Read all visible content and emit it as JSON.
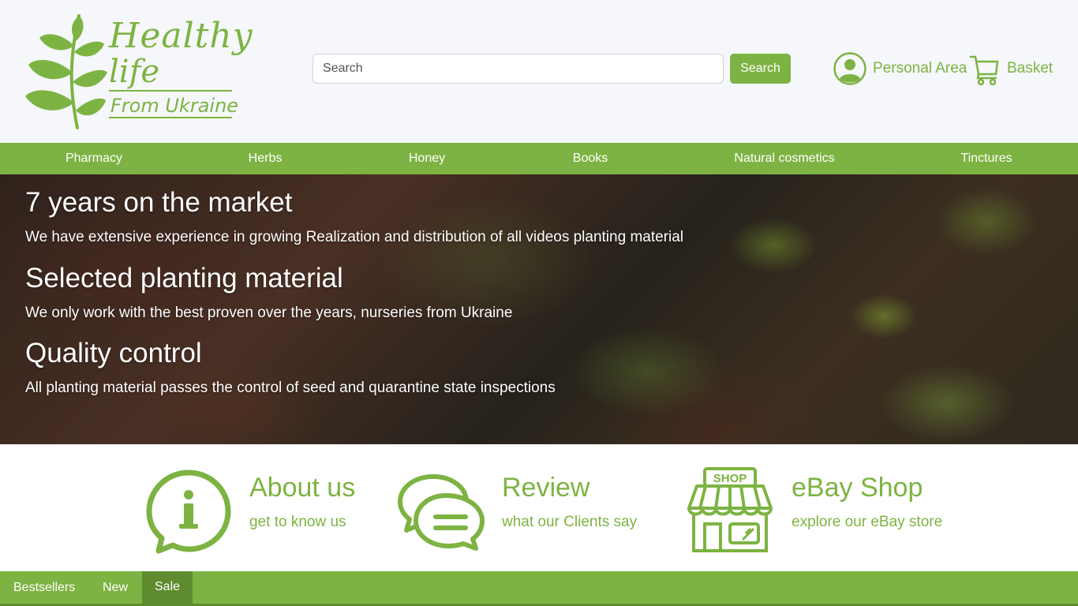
{
  "brand": {
    "logo_line1": "Healthy",
    "logo_line2": "life",
    "logo_line3": "From Ukraine",
    "accent_color": "#7db342"
  },
  "header": {
    "search": {
      "placeholder": "Search",
      "value": "",
      "button_label": "Search"
    },
    "account_label": "Personal Area",
    "account_icon": "user-circle-icon",
    "basket_label": "Basket",
    "basket_icon": "cart-icon"
  },
  "nav": {
    "items": [
      "Pharmacy",
      "Herbs",
      "Honey",
      "Books",
      "Natural cosmetics",
      "Tinctures"
    ]
  },
  "hero": {
    "blocks": [
      {
        "title": "7 years on the market",
        "text": "We have extensive experience in growing Realization and distribution of all videos planting material"
      },
      {
        "title": "Selected planting material",
        "text": "We only work with the best proven over the years, nurseries from Ukraine"
      },
      {
        "title": "Quality control",
        "text": "All planting material passes the control of seed and quarantine state inspections"
      }
    ]
  },
  "info": {
    "items": [
      {
        "title": "About us",
        "subtitle": "get to know us",
        "icon": "info-bubble-icon"
      },
      {
        "title": "Review",
        "subtitle": "what our Clients say",
        "icon": "chat-bubbles-icon"
      },
      {
        "title": "eBay Shop",
        "subtitle": "explore our eBay store",
        "icon": "shop-icon",
        "icon_text": "SHOP"
      }
    ]
  },
  "tabs": {
    "items": [
      "Bestsellers",
      "New",
      "Sale"
    ],
    "active": "Sale"
  }
}
